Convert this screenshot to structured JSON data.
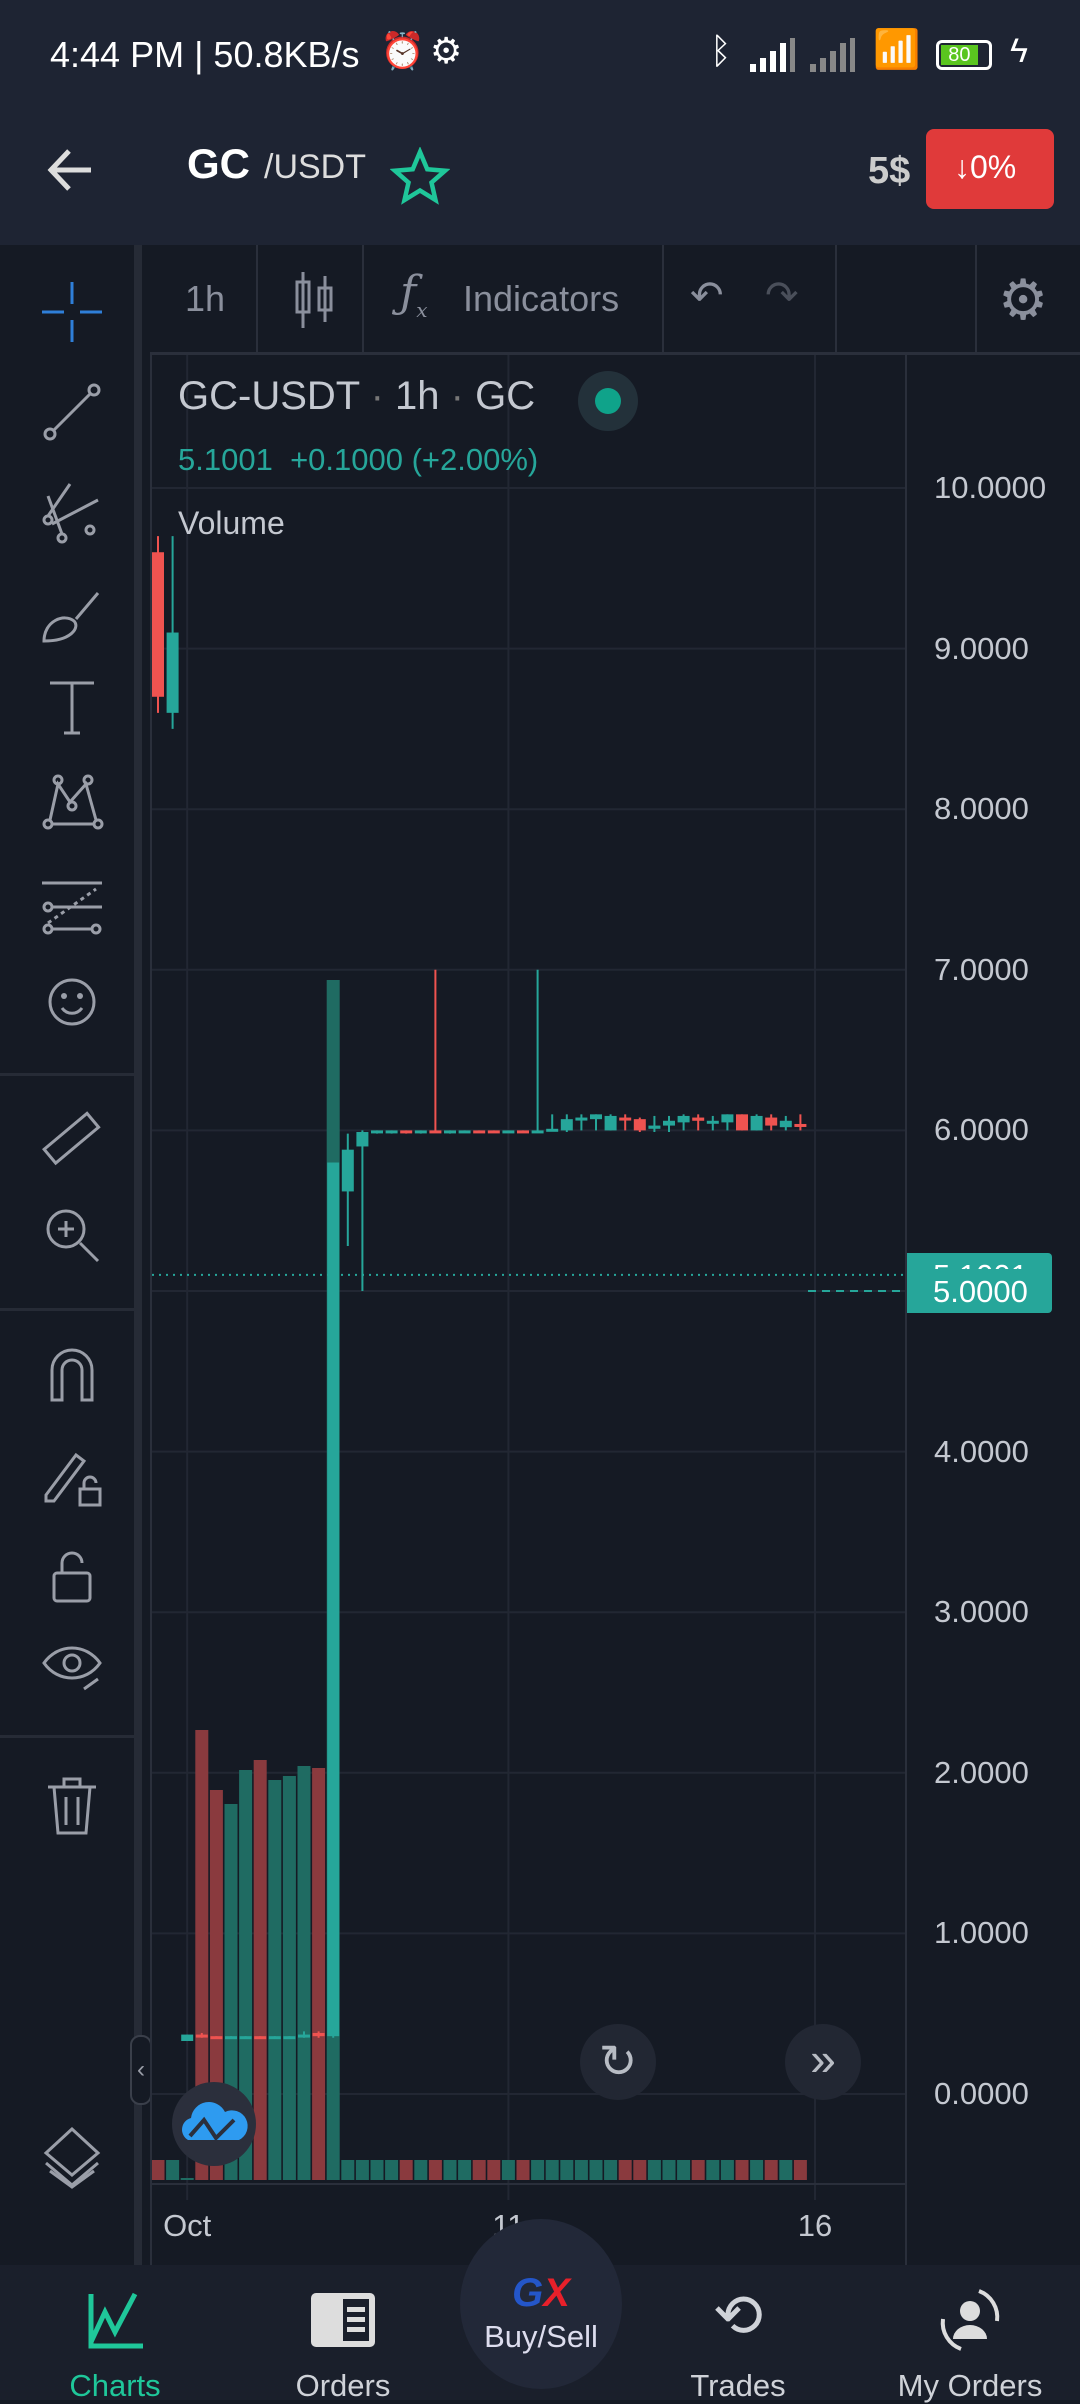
{
  "status_bar": {
    "time": "4:44 PM | 50.8KB/s",
    "battery": "80"
  },
  "header": {
    "base": "GC",
    "quote": "/USDT",
    "price": "5$",
    "change": "0%",
    "change_color": "#e03a3a",
    "accent": "#1fc79a"
  },
  "toolbar": {
    "interval": "1h",
    "indicators_label": "Indicators"
  },
  "legend": {
    "title": "GC-USDT",
    "interval": "1h",
    "exchange": "GC",
    "last": "5.1001",
    "change": "+0.1000 (+2.00%)",
    "volume_label": "Volume"
  },
  "nav": {
    "charts": "Charts",
    "orders": "Orders",
    "buysell": "Buy/Sell",
    "trades": "Trades",
    "myorders": "My Orders"
  },
  "chart_data": {
    "type": "candlestick",
    "up_color": "#26a69a",
    "down_color": "#ef5350",
    "ylim": [
      0,
      10
    ],
    "y_ticks": [
      "10.0000",
      "9.0000",
      "8.0000",
      "7.0000",
      "6.0000",
      "5.0000",
      "4.0000",
      "3.0000",
      "2.0000",
      "1.0000",
      "0.0000"
    ],
    "price_labels": [
      {
        "value": 5.1001,
        "text": "5.1001"
      },
      {
        "value": 5.0,
        "text": "5.0000"
      }
    ],
    "x_ticks": [
      {
        "label": "Oct",
        "index": 2
      },
      {
        "label": "11",
        "index": 24
      },
      {
        "label": "16",
        "index": 45
      }
    ],
    "candles": [
      {
        "o": 9.6,
        "h": 9.7,
        "l": 8.6,
        "c": 8.7,
        "v": 0.1
      },
      {
        "o": 8.6,
        "h": 9.7,
        "l": 8.5,
        "c": 9.1,
        "v": 0.1
      },
      {
        "o": 0.33,
        "h": 0.37,
        "l": 0.33,
        "c": 0.37,
        "v": 0.01
      },
      {
        "o": 0.37,
        "h": 0.38,
        "l": 0.35,
        "c": 0.36,
        "v": 2.25
      },
      {
        "o": 0.36,
        "h": 0.36,
        "l": 0.35,
        "c": 0.35,
        "v": 1.95
      },
      {
        "o": 0.35,
        "h": 0.36,
        "l": 0.35,
        "c": 0.36,
        "v": 1.88
      },
      {
        "o": 0.35,
        "h": 0.36,
        "l": 0.35,
        "c": 0.36,
        "v": 2.05
      },
      {
        "o": 0.36,
        "h": 0.36,
        "l": 0.35,
        "c": 0.35,
        "v": 2.1
      },
      {
        "o": 0.35,
        "h": 0.36,
        "l": 0.35,
        "c": 0.36,
        "v": 2.0
      },
      {
        "o": 0.35,
        "h": 0.36,
        "l": 0.35,
        "c": 0.36,
        "v": 2.02
      },
      {
        "o": 0.36,
        "h": 0.39,
        "l": 0.35,
        "c": 0.37,
        "v": 2.07
      },
      {
        "o": 0.38,
        "h": 0.39,
        "l": 0.35,
        "c": 0.36,
        "v": 2.06
      },
      {
        "o": 0.36,
        "h": 5.8,
        "l": 0.35,
        "c": 5.8,
        "v": 6.0
      },
      {
        "o": 5.62,
        "h": 5.98,
        "l": 5.28,
        "c": 5.88,
        "v": 0.1
      },
      {
        "o": 5.9,
        "h": 6.0,
        "l": 5.0,
        "c": 5.99,
        "v": 0.1
      },
      {
        "o": 5.99,
        "h": 6.0,
        "l": 5.98,
        "c": 6.0,
        "v": 0.1
      },
      {
        "o": 5.99,
        "h": 6.0,
        "l": 5.98,
        "c": 6.0,
        "v": 0.1
      },
      {
        "o": 6.0,
        "h": 6.0,
        "l": 5.98,
        "c": 5.99,
        "v": 0.1
      },
      {
        "o": 5.99,
        "h": 6.0,
        "l": 5.98,
        "c": 6.0,
        "v": 0.1
      },
      {
        "o": 6.0,
        "h": 7.0,
        "l": 5.99,
        "c": 5.99,
        "v": 0.1
      },
      {
        "o": 5.99,
        "h": 6.0,
        "l": 5.98,
        "c": 6.0,
        "v": 0.1
      },
      {
        "o": 5.99,
        "h": 6.0,
        "l": 5.99,
        "c": 6.0,
        "v": 0.1
      },
      {
        "o": 6.0,
        "h": 6.0,
        "l": 5.99,
        "c": 5.99,
        "v": 0.1
      },
      {
        "o": 6.0,
        "h": 6.0,
        "l": 5.99,
        "c": 5.99,
        "v": 0.1
      },
      {
        "o": 5.99,
        "h": 6.0,
        "l": 5.99,
        "c": 6.0,
        "v": 0.1
      },
      {
        "o": 6.0,
        "h": 6.0,
        "l": 5.99,
        "c": 5.99,
        "v": 0.1
      },
      {
        "o": 5.99,
        "h": 7.0,
        "l": 5.99,
        "c": 6.0,
        "v": 0.1
      },
      {
        "o": 6.0,
        "h": 6.1,
        "l": 6.0,
        "c": 6.01,
        "v": 0.1
      },
      {
        "o": 6.0,
        "h": 6.1,
        "l": 5.99,
        "c": 6.07,
        "v": 0.1
      },
      {
        "o": 6.07,
        "h": 6.1,
        "l": 6.0,
        "c": 6.08,
        "v": 0.1
      },
      {
        "o": 6.07,
        "h": 6.1,
        "l": 6.0,
        "c": 6.1,
        "v": 0.1
      },
      {
        "o": 6.0,
        "h": 6.1,
        "l": 6.0,
        "c": 6.09,
        "v": 0.1
      },
      {
        "o": 6.08,
        "h": 6.1,
        "l": 6.0,
        "c": 6.07,
        "v": 0.1
      },
      {
        "o": 6.07,
        "h": 6.08,
        "l": 5.99,
        "c": 6.0,
        "v": 0.1
      },
      {
        "o": 6.01,
        "h": 6.09,
        "l": 5.99,
        "c": 6.03,
        "v": 0.1
      },
      {
        "o": 6.03,
        "h": 6.09,
        "l": 5.99,
        "c": 6.06,
        "v": 0.1
      },
      {
        "o": 6.05,
        "h": 6.1,
        "l": 6.0,
        "c": 6.09,
        "v": 0.1
      },
      {
        "o": 6.08,
        "h": 6.1,
        "l": 6.0,
        "c": 6.06,
        "v": 0.1
      },
      {
        "o": 6.06,
        "h": 6.09,
        "l": 6.0,
        "c": 6.06,
        "v": 0.1
      },
      {
        "o": 6.05,
        "h": 6.1,
        "l": 6.0,
        "c": 6.1,
        "v": 0.1
      },
      {
        "o": 6.1,
        "h": 6.1,
        "l": 6.0,
        "c": 6.0,
        "v": 0.1
      },
      {
        "o": 6.0,
        "h": 6.1,
        "l": 6.0,
        "c": 6.09,
        "v": 0.1
      },
      {
        "o": 6.08,
        "h": 6.1,
        "l": 6.0,
        "c": 6.03,
        "v": 0.1
      },
      {
        "o": 6.02,
        "h": 6.09,
        "l": 6.0,
        "c": 6.06,
        "v": 0.1
      },
      {
        "o": 6.04,
        "h": 6.1,
        "l": 6.0,
        "c": 6.03,
        "v": 0.1
      }
    ]
  }
}
